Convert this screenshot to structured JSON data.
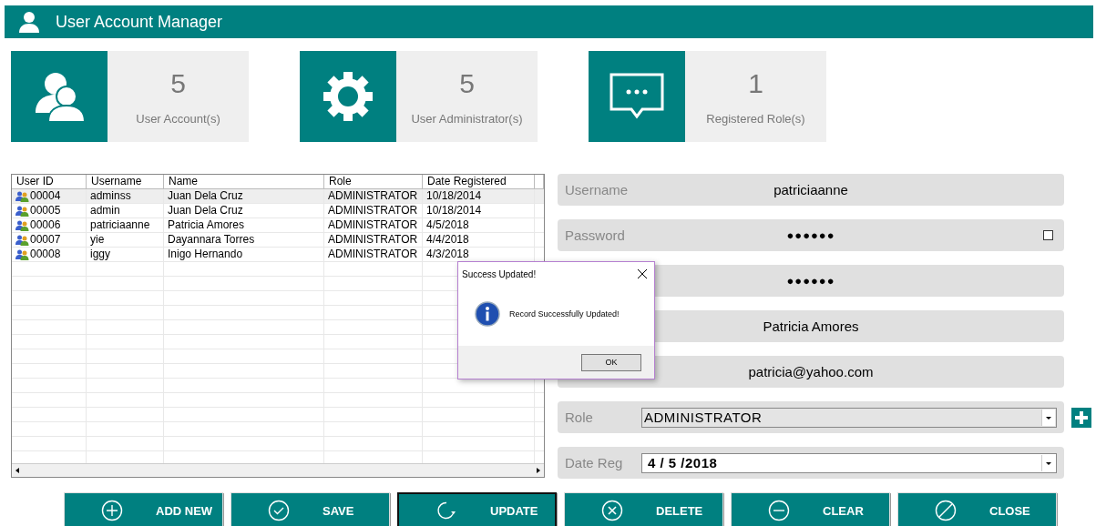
{
  "window": {
    "title": "User Account Manager"
  },
  "stats": [
    {
      "kind": "users",
      "count": "5",
      "label": "User Account(s)"
    },
    {
      "kind": "gear",
      "count": "5",
      "label": "User Administrator(s)"
    },
    {
      "kind": "chat",
      "count": "1",
      "label": "Registered Role(s)"
    }
  ],
  "table": {
    "columns": [
      "User ID",
      "Username",
      "Name",
      "Role",
      "Date Registered"
    ],
    "rows": [
      {
        "cells": [
          "00004",
          "adminss",
          "Juan Dela Cruz",
          "ADMINISTRATOR",
          "10/18/2014"
        ],
        "selected": true
      },
      {
        "cells": [
          "00005",
          "admin",
          "Juan Dela Cruz",
          "ADMINISTRATOR",
          "10/18/2014"
        ],
        "selected": false
      },
      {
        "cells": [
          "00006",
          "patriciaanne",
          "Patricia Amores",
          "ADMINISTRATOR",
          "4/5/2018"
        ],
        "selected": false
      },
      {
        "cells": [
          "00007",
          "yie",
          "Dayannara Torres",
          "ADMINISTRATOR",
          "4/4/2018"
        ],
        "selected": false
      },
      {
        "cells": [
          "00008",
          "iggy",
          "Inigo Hernando",
          "ADMINISTRATOR",
          "4/3/2018"
        ],
        "selected": false
      }
    ]
  },
  "form": [
    {
      "kind": "text",
      "label": "Username",
      "value": "patriciaanne"
    },
    {
      "kind": "password",
      "label": "Password",
      "value": "●●●●●●",
      "show_checked": false
    },
    {
      "kind": "password",
      "value": "●●●●●●"
    },
    {
      "kind": "text",
      "value": "Patricia Amores"
    },
    {
      "kind": "text",
      "value": "patricia@yahoo.com"
    },
    {
      "kind": "combo",
      "label": "Role",
      "value": "ADMINISTRATOR"
    },
    {
      "kind": "date",
      "label": "Date Reg",
      "value": "4 / 5 /2018"
    }
  ],
  "buttons": [
    {
      "kind": "plus",
      "label": "ADD NEW",
      "focused": false
    },
    {
      "kind": "check",
      "label": "SAVE",
      "focused": false
    },
    {
      "kind": "refresh",
      "label": "UPDATE",
      "focused": true
    },
    {
      "kind": "x",
      "label": "DELETE",
      "focused": false
    },
    {
      "kind": "minus",
      "label": "CLEAR",
      "focused": false
    },
    {
      "kind": "slash",
      "label": "CLOSE",
      "focused": false
    }
  ],
  "dialog": {
    "title": "Success Updated!",
    "message": "Record Successfully Updated!",
    "button": "OK"
  }
}
